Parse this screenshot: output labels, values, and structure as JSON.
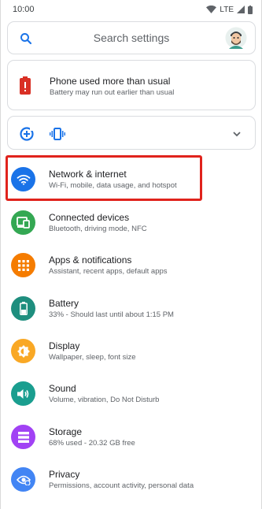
{
  "status_bar": {
    "time": "10:00",
    "network": "LTE"
  },
  "search": {
    "placeholder": "Search settings"
  },
  "suggestion": {
    "title": "Phone used more than usual",
    "subtitle": "Battery may run out earlier than usual"
  },
  "settings": [
    {
      "title": "Network & internet",
      "subtitle": "Wi-Fi, mobile, data usage, and hotspot",
      "color": "#1a73e8",
      "icon": "wifi-icon"
    },
    {
      "title": "Connected devices",
      "subtitle": "Bluetooth, driving mode, NFC",
      "color": "#34a853",
      "icon": "devices-icon"
    },
    {
      "title": "Apps & notifications",
      "subtitle": "Assistant, recent apps, default apps",
      "color": "#f57c00",
      "icon": "apps-icon"
    },
    {
      "title": "Battery",
      "subtitle": "33% - Should last until about 1:15 PM",
      "color": "#1e8e7e",
      "icon": "battery-icon"
    },
    {
      "title": "Display",
      "subtitle": "Wallpaper, sleep, font size",
      "color": "#f9a825",
      "icon": "brightness-icon"
    },
    {
      "title": "Sound",
      "subtitle": "Volume, vibration, Do Not Disturb",
      "color": "#1a9e8f",
      "icon": "volume-icon"
    },
    {
      "title": "Storage",
      "subtitle": "68% used - 20.32 GB free",
      "color": "#a142f4",
      "icon": "storage-icon"
    },
    {
      "title": "Privacy",
      "subtitle": "Permissions, account activity, personal data",
      "color": "#4285f4",
      "icon": "privacy-eye-icon"
    }
  ],
  "colors": {
    "accent": "#1a73e8",
    "highlight": "#e0231c",
    "alert": "#d93025"
  }
}
